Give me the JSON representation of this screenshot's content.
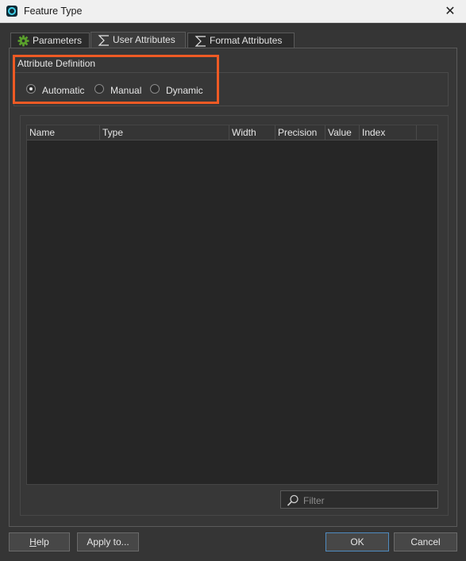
{
  "window": {
    "title": "Feature Type",
    "close_glyph": "✕"
  },
  "tabs": [
    {
      "label": "Parameters",
      "icon": "gear-icon",
      "active": false
    },
    {
      "label": "User Attributes",
      "icon": "sigma-icon",
      "active": true
    },
    {
      "label": "Format Attributes",
      "icon": "sigma-icon",
      "active": false
    }
  ],
  "attribute_definition": {
    "title": "Attribute Definition",
    "options": [
      {
        "label": "Automatic",
        "selected": true
      },
      {
        "label": "Manual",
        "selected": false
      },
      {
        "label": "Dynamic",
        "selected": false
      }
    ]
  },
  "attributes_table": {
    "columns": [
      "Name",
      "Type",
      "Width",
      "Precision",
      "Value",
      "Index"
    ],
    "rows": []
  },
  "filter": {
    "placeholder": "Filter",
    "value": ""
  },
  "buttons": {
    "help_mnemonic": "H",
    "help_rest": "elp",
    "apply_to": "Apply to...",
    "ok": "OK",
    "cancel": "Cancel"
  },
  "colors": {
    "highlight": "#ef5a24",
    "background": "#353535",
    "accent": "#4f8bbf"
  }
}
